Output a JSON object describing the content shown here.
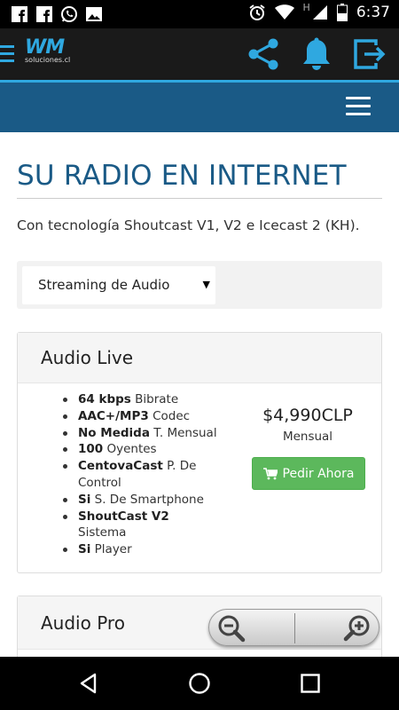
{
  "status_bar": {
    "time": "6:37",
    "carrier_letter": "H",
    "left_icons": [
      "facebook-icon",
      "facebook-icon",
      "whatsapp-icon",
      "image-icon"
    ],
    "right_icons": [
      "alarm-icon",
      "wifi-icon",
      "signal-icon",
      "battery-icon"
    ]
  },
  "header": {
    "logo_main": "WM",
    "logo_sub": "soluciones.cl",
    "icons": [
      "share-icon",
      "bell-icon",
      "logout-icon"
    ],
    "accent_color": "#2fa8e0"
  },
  "nav": {
    "background": "#1a5a86",
    "menu_icon": "hamburger-icon"
  },
  "main": {
    "title": "SU RADIO EN INTERNET",
    "subtitle": "Con tecnología Shoutcast V1, V2 e Icecast 2 (KH).",
    "select": {
      "value": "Streaming de Audio"
    }
  },
  "plans": [
    {
      "name": "Audio Live",
      "features": [
        {
          "bold": "64 kbps",
          "text": " Bibrate"
        },
        {
          "bold": "AAC+/MP3",
          "text": " Codec"
        },
        {
          "bold": "No Medida",
          "text": " T. Mensual"
        },
        {
          "bold": "100",
          "text": " Oyentes"
        },
        {
          "bold": "CentovaCast",
          "text": " P. De Control"
        },
        {
          "bold": "Si",
          "text": " S. De Smartphone"
        },
        {
          "bold": "ShoutCast V2",
          "text": " Sistema"
        },
        {
          "bold": "Si",
          "text": " Player"
        }
      ],
      "price": "$4,990CLP",
      "period": "Mensual",
      "button": "Pedir Ahora"
    },
    {
      "name": "Audio Pro"
    }
  ],
  "zoom_controls": [
    "zoom-out-icon",
    "zoom-in-icon"
  ],
  "android_nav": [
    "back-icon",
    "home-icon",
    "recents-icon"
  ]
}
